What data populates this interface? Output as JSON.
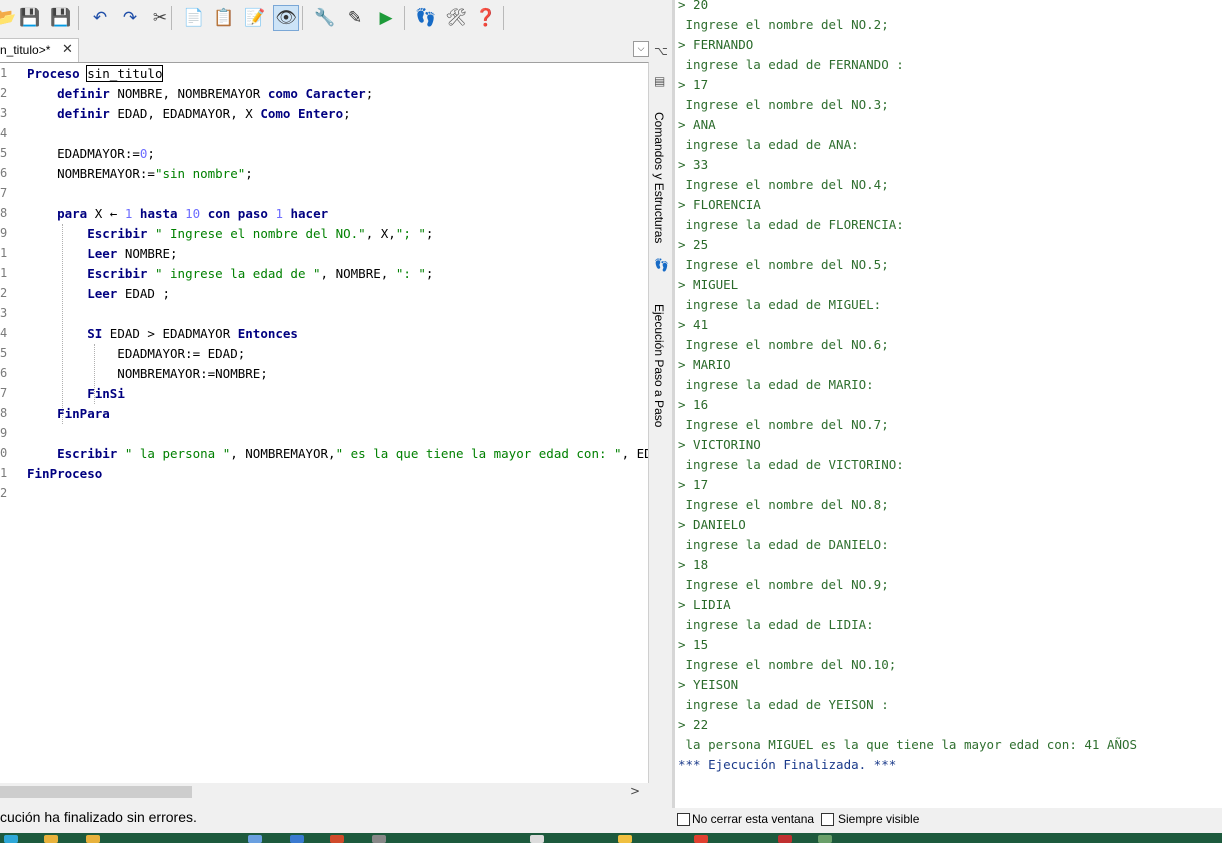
{
  "toolbar": {
    "icons": [
      "open-icon",
      "save-icon",
      "save-as-icon",
      "undo-icon",
      "redo-icon",
      "cut-icon",
      "copy-icon",
      "paste-icon",
      "edit-flowchart-icon",
      "view-flowchart-icon",
      "tools-icon",
      "pen-icon",
      "run-icon",
      "step-icon",
      "debug-icon",
      "help-icon"
    ]
  },
  "tab": {
    "label": "n_titulo>*",
    "close": "✕"
  },
  "editor": {
    "lines": [
      {
        "n": "1",
        "html": "<span class='kw'>Proceso</span> <span style='outline:1px solid #000'>sin_titulo</span>"
      },
      {
        "n": "2",
        "html": "    <span class='kw'>definir</span> NOMBRE, NOMBREMAYOR <span class='kw'>como Caracter</span>;"
      },
      {
        "n": "3",
        "html": "    <span class='kw'>definir</span> EDAD, EDADMAYOR, X <span class='kw'>Como Entero</span>;"
      },
      {
        "n": "4",
        "html": ""
      },
      {
        "n": "5",
        "html": "    EDADMAYOR:=<span class='num'>0</span>;"
      },
      {
        "n": "6",
        "html": "    NOMBREMAYOR:=<span class='str'>\"sin nombre\"</span>;"
      },
      {
        "n": "7",
        "html": ""
      },
      {
        "n": "8",
        "html": "    <span class='kw'>para</span> X &larr; <span class='num'>1</span> <span class='kw'>hasta</span> <span class='num'>10</span> <span class='kw'>con paso</span> <span class='num'>1</span> <span class='kw'>hacer</span>"
      },
      {
        "n": "9",
        "html": "        <span class='kw'>Escribir</span> <span class='str'>\" Ingrese el nombre del NO.\"</span>, X,<span class='str'>\"; \"</span>;"
      },
      {
        "n": "1",
        "html": "        <span class='kw'>Leer</span> NOMBRE;"
      },
      {
        "n": "1",
        "html": "        <span class='kw'>Escribir</span> <span class='str'>\" ingrese la edad de \"</span>, NOMBRE, <span class='str'>\": \"</span>;"
      },
      {
        "n": "2",
        "html": "        <span class='kw'>Leer</span> EDAD ;"
      },
      {
        "n": "3",
        "html": ""
      },
      {
        "n": "4",
        "html": "        <span class='kw'>SI</span> EDAD &gt; EDADMAYOR <span class='kw'>Entonces</span>"
      },
      {
        "n": "5",
        "html": "            EDADMAYOR:= EDAD;"
      },
      {
        "n": "6",
        "html": "            NOMBREMAYOR:=NOMBRE;"
      },
      {
        "n": "7",
        "html": "        <span class='kw'>FinSi</span>"
      },
      {
        "n": "8",
        "html": "    <span class='kw'>FinPara</span>"
      },
      {
        "n": "9",
        "html": ""
      },
      {
        "n": "0",
        "html": "    <span class='kw'>Escribir</span> <span class='str'>\" la persona \"</span>, NOMBREMAYOR,<span class='str'>\" es la que tiene la mayor edad con: \"</span>, EDADM/"
      },
      {
        "n": "1",
        "html": "<span class='kw'>FinProceso</span>"
      },
      {
        "n": "2",
        "html": ""
      }
    ]
  },
  "status": {
    "text": "cución ha finalizado sin errores."
  },
  "side_panel": {
    "commands_label": "Comandos y Estructuras",
    "step_label": "Ejecución Paso a Paso"
  },
  "console": {
    "lines": [
      {
        "text": "> 20",
        "kind": "in"
      },
      {
        "text": " Ingrese el nombre del NO.2;",
        "kind": "out"
      },
      {
        "text": "> FERNANDO",
        "kind": "in"
      },
      {
        "text": " ingrese la edad de FERNANDO :",
        "kind": "out"
      },
      {
        "text": "> 17",
        "kind": "in"
      },
      {
        "text": " Ingrese el nombre del NO.3;",
        "kind": "out"
      },
      {
        "text": "> ANA",
        "kind": "in"
      },
      {
        "text": " ingrese la edad de ANA:",
        "kind": "out"
      },
      {
        "text": "> 33",
        "kind": "in"
      },
      {
        "text": " Ingrese el nombre del NO.4;",
        "kind": "out"
      },
      {
        "text": "> FLORENCIA",
        "kind": "in"
      },
      {
        "text": " ingrese la edad de FLORENCIA:",
        "kind": "out"
      },
      {
        "text": "> 25",
        "kind": "in"
      },
      {
        "text": " Ingrese el nombre del NO.5;",
        "kind": "out"
      },
      {
        "text": "> MIGUEL",
        "kind": "in"
      },
      {
        "text": " ingrese la edad de MIGUEL:",
        "kind": "out"
      },
      {
        "text": "> 41",
        "kind": "in"
      },
      {
        "text": " Ingrese el nombre del NO.6;",
        "kind": "out"
      },
      {
        "text": "> MARIO",
        "kind": "in"
      },
      {
        "text": " ingrese la edad de MARIO:",
        "kind": "out"
      },
      {
        "text": "> 16",
        "kind": "in"
      },
      {
        "text": " Ingrese el nombre del NO.7;",
        "kind": "out"
      },
      {
        "text": "> VICTORINO",
        "kind": "in"
      },
      {
        "text": " ingrese la edad de VICTORINO:",
        "kind": "out"
      },
      {
        "text": "> 17",
        "kind": "in"
      },
      {
        "text": " Ingrese el nombre del NO.8;",
        "kind": "out"
      },
      {
        "text": "> DANIELO",
        "kind": "in"
      },
      {
        "text": " ingrese la edad de DANIELO:",
        "kind": "out"
      },
      {
        "text": "> 18",
        "kind": "in"
      },
      {
        "text": " Ingrese el nombre del NO.9;",
        "kind": "out"
      },
      {
        "text": "> LIDIA",
        "kind": "in"
      },
      {
        "text": " ingrese la edad de LIDIA:",
        "kind": "out"
      },
      {
        "text": "> 15",
        "kind": "in"
      },
      {
        "text": " Ingrese el nombre del NO.10;",
        "kind": "out"
      },
      {
        "text": "> YEISON",
        "kind": "in"
      },
      {
        "text": " ingrese la edad de YEISON :",
        "kind": "out"
      },
      {
        "text": "> 22",
        "kind": "in"
      },
      {
        "text": " la persona MIGUEL es la que tiene la mayor edad con: 41 AÑOS",
        "kind": "out"
      },
      {
        "text": "*** Ejecución Finalizada. ***",
        "kind": "fin"
      }
    ]
  },
  "options": {
    "no_close_label": "No cerrar esta ventana",
    "always_visible_label": "Siempre visible"
  },
  "colors": {
    "taskbar": "#1d5a3d",
    "keyword": "#000080",
    "string": "#008000",
    "console_text": "#2f6f2f"
  }
}
